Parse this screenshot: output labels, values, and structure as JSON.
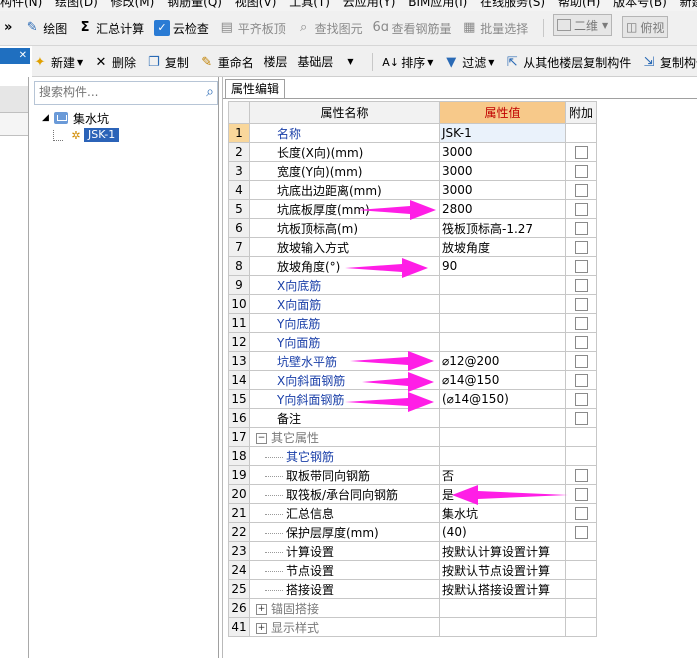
{
  "menubar": [
    "构件(N)",
    "绘图(D)",
    "修改(M)",
    "钢筋量(Q)",
    "视图(V)",
    "工具(T)",
    "云应用(Y)",
    "BIM应用(I)",
    "在线服务(S)",
    "帮助(H)",
    "版本号(B)",
    "新建变"
  ],
  "toolbar1": {
    "draw": "绘图",
    "sum": "汇总计算",
    "cloud_check": "云检查",
    "flat_top": "平齐板顶",
    "find_elem": "查找图元",
    "view_rebar": "查看钢筋量",
    "batch_select": "批量选择",
    "view2d": "二维",
    "top_view": "俯视"
  },
  "toolbar2": {
    "new": "新建",
    "delete": "删除",
    "copy": "复制",
    "rename": "重命名",
    "floor_label": "楼层",
    "floor_value": "基础层",
    "sort": "排序",
    "filter": "过滤",
    "copy_from_floor": "从其他楼层复制构件",
    "copy_to_floor": "复制构件到"
  },
  "search": {
    "placeholder": "搜索构件..."
  },
  "tree": {
    "root": "集水坑",
    "child": "JSK-1"
  },
  "prop_tab": "属性编辑",
  "headers": {
    "name": "属性名称",
    "value": "属性值",
    "extra": "附加"
  },
  "rows": [
    {
      "num": "1",
      "name": "名称",
      "value": "JSK-1"
    },
    {
      "num": "2",
      "name": "长度(X向)(mm)",
      "value": "3000"
    },
    {
      "num": "3",
      "name": "宽度(Y向)(mm)",
      "value": "3000"
    },
    {
      "num": "4",
      "name": "坑底出边距离(mm)",
      "value": "3000"
    },
    {
      "num": "5",
      "name": "坑底板厚度(mm)",
      "value": "2800"
    },
    {
      "num": "6",
      "name": "坑板顶标高(m)",
      "value": "筏板顶标高-1.27"
    },
    {
      "num": "7",
      "name": "放坡输入方式",
      "value": "放坡角度"
    },
    {
      "num": "8",
      "name": "放坡角度(°)",
      "value": "90"
    },
    {
      "num": "9",
      "name": "X向底筋",
      "value": ""
    },
    {
      "num": "10",
      "name": "X向面筋",
      "value": ""
    },
    {
      "num": "11",
      "name": "Y向底筋",
      "value": ""
    },
    {
      "num": "12",
      "name": "Y向面筋",
      "value": ""
    },
    {
      "num": "13",
      "name": "坑壁水平筋",
      "value": "⌀12@200"
    },
    {
      "num": "14",
      "name": "X向斜面钢筋",
      "value": "⌀14@150"
    },
    {
      "num": "15",
      "name": "Y向斜面钢筋",
      "value": "(⌀14@150)"
    },
    {
      "num": "16",
      "name": "备注",
      "value": ""
    },
    {
      "num": "17",
      "name": "其它属性",
      "value": ""
    },
    {
      "num": "18",
      "name": "其它钢筋",
      "value": ""
    },
    {
      "num": "19",
      "name": "取板带同向钢筋",
      "value": "否"
    },
    {
      "num": "20",
      "name": "取筏板/承台同向钢筋",
      "value": "是"
    },
    {
      "num": "21",
      "name": "汇总信息",
      "value": "集水坑"
    },
    {
      "num": "22",
      "name": "保护层厚度(mm)",
      "value": "(40)"
    },
    {
      "num": "23",
      "name": "计算设置",
      "value": "按默认计算设置计算"
    },
    {
      "num": "24",
      "name": "节点设置",
      "value": "按默认节点设置计算"
    },
    {
      "num": "25",
      "name": "搭接设置",
      "value": "按默认搭接设置计算"
    },
    {
      "num": "26",
      "name": "锚固搭接",
      "value": ""
    },
    {
      "num": "41",
      "name": "显示样式",
      "value": ""
    }
  ],
  "colors": {
    "arrow": "#ff1ee6",
    "selection": "#2b63b8",
    "header_value_bg": "#f7c98a"
  }
}
